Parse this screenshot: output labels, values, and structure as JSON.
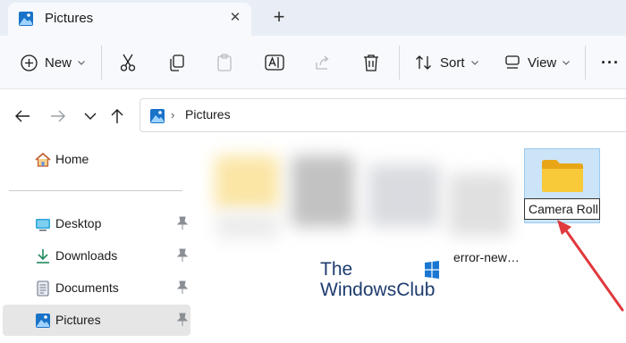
{
  "window": {
    "tab_title": "Pictures",
    "tab_close": "✕",
    "new_tab": "+"
  },
  "toolbar": {
    "new_label": "New",
    "sort_label": "Sort",
    "view_label": "View",
    "more_label": "···"
  },
  "address": {
    "crumb": "Pictures"
  },
  "sidebar": {
    "home": "Home",
    "items": [
      {
        "label": "Desktop",
        "icon": "desktop-icon"
      },
      {
        "label": "Downloads",
        "icon": "download-icon"
      },
      {
        "label": "Documents",
        "icon": "documents-icon"
      },
      {
        "label": "Pictures",
        "icon": "pictures-icon",
        "selected": true
      }
    ]
  },
  "content": {
    "file_label": "error-new…",
    "folder_rename_value": "Camera Roll"
  },
  "watermark": {
    "line1": "The",
    "line2": "WindowsClub"
  },
  "colors": {
    "accent": "#0067c0",
    "folder": "#f8c938",
    "arrow": "#e0393e"
  }
}
